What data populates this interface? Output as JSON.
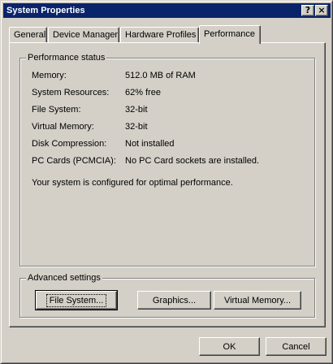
{
  "window": {
    "title": "System Properties",
    "help_label": "?",
    "close_label": "×"
  },
  "tabs": [
    {
      "label": "General"
    },
    {
      "label": "Device Manager"
    },
    {
      "label": "Hardware Profiles"
    },
    {
      "label": "Performance",
      "active": true
    }
  ],
  "status": {
    "group_title": "Performance status",
    "rows": [
      {
        "label": "Memory:",
        "value": "512.0 MB of RAM"
      },
      {
        "label": "System Resources:",
        "value": "62% free"
      },
      {
        "label": "File System:",
        "value": "32-bit"
      },
      {
        "label": "Virtual Memory:",
        "value": "32-bit"
      },
      {
        "label": "Disk Compression:",
        "value": "Not installed"
      },
      {
        "label": "PC Cards (PCMCIA):",
        "value": "No PC Card sockets are installed."
      }
    ],
    "message": "Your system is configured for optimal performance."
  },
  "advanced": {
    "group_title": "Advanced settings",
    "file_system_label": "File System...",
    "graphics_label": "Graphics...",
    "virtual_memory_label": "Virtual Memory..."
  },
  "footer": {
    "ok_label": "OK",
    "cancel_label": "Cancel"
  },
  "icons": {
    "cursor": "arrow-cursor-icon"
  }
}
